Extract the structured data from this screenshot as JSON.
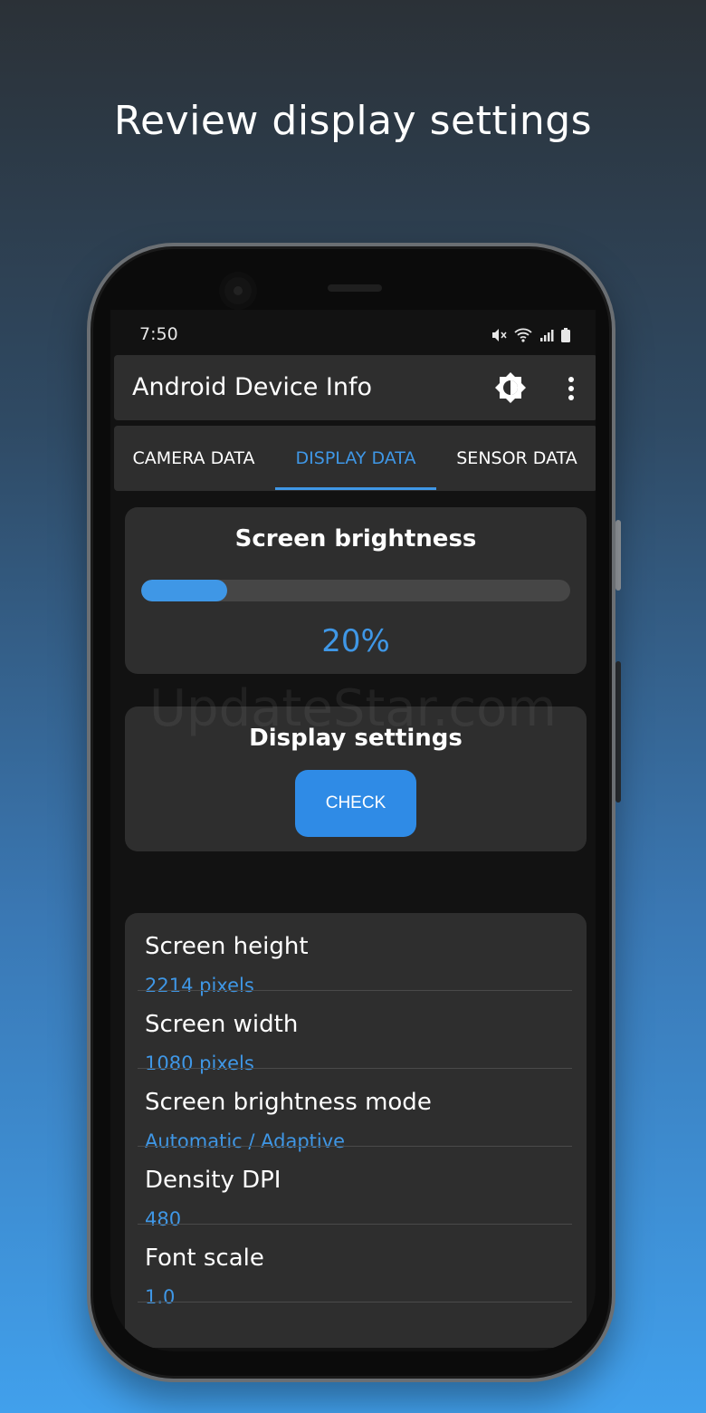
{
  "headline": "Review display settings",
  "watermark": "UpdateStar.com",
  "status": {
    "time": "7:50"
  },
  "app": {
    "title": "Android Device Info"
  },
  "tabs": [
    {
      "label": "CAMERA DATA"
    },
    {
      "label": "DISPLAY DATA"
    },
    {
      "label": "SENSOR DATA"
    }
  ],
  "brightness": {
    "title": "Screen brightness",
    "percent_label": "20%",
    "value": 0.2
  },
  "display_settings": {
    "title": "Display settings",
    "check_label": "CHECK"
  },
  "rows": [
    {
      "label": "Screen height",
      "value": "2214 pixels"
    },
    {
      "label": "Screen width",
      "value": "1080 pixels"
    },
    {
      "label": "Screen brightness mode",
      "value": "Automatic / Adaptive"
    },
    {
      "label": "Density DPI",
      "value": "480"
    },
    {
      "label": "Font scale",
      "value": "1.0"
    }
  ],
  "colors": {
    "accent": "#3f97e6",
    "card": "#2e2e2e",
    "background": "#121212"
  }
}
